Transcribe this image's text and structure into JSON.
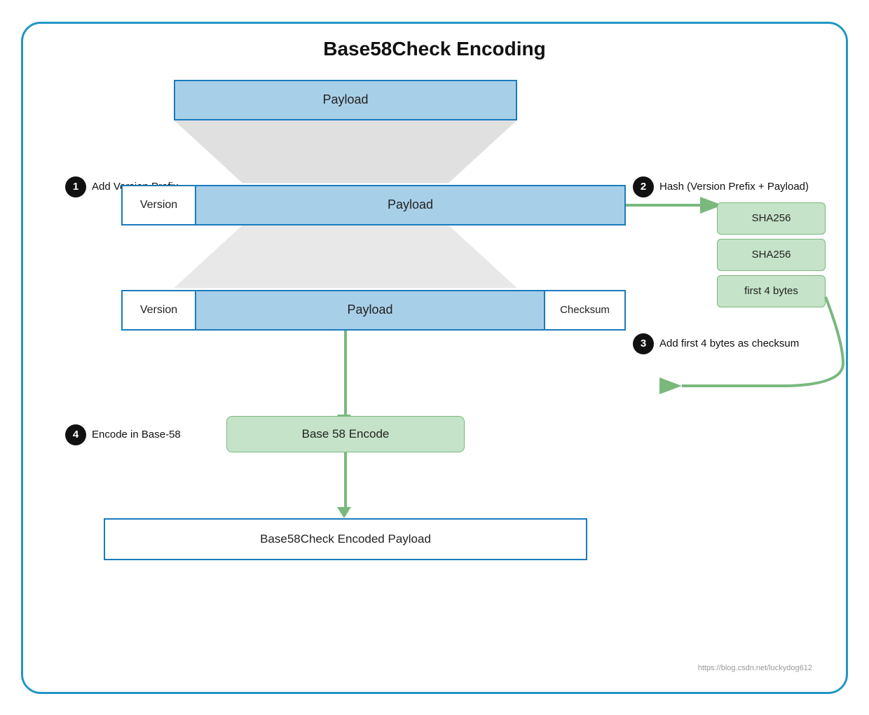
{
  "title": "Base58Check Encoding",
  "payload_top": "Payload",
  "step1": {
    "number": "1",
    "label": "Add Version Prefix"
  },
  "step2": {
    "number": "2",
    "label": "Hash (Version Prefix + Payload)"
  },
  "step3": {
    "number": "3",
    "label": "Add first 4 bytes as checksum"
  },
  "step4": {
    "number": "4",
    "label": "Encode in Base-58"
  },
  "version_label": "Version",
  "payload_label": "Payload",
  "checksum_label": "Checksum",
  "sha_boxes": [
    "SHA256",
    "SHA256",
    "first 4 bytes"
  ],
  "base58_encode_label": "Base 58 Encode",
  "final_box_label": "Base58Check Encoded Payload",
  "watermark": "https://blog.csdn.net/luckydog612"
}
